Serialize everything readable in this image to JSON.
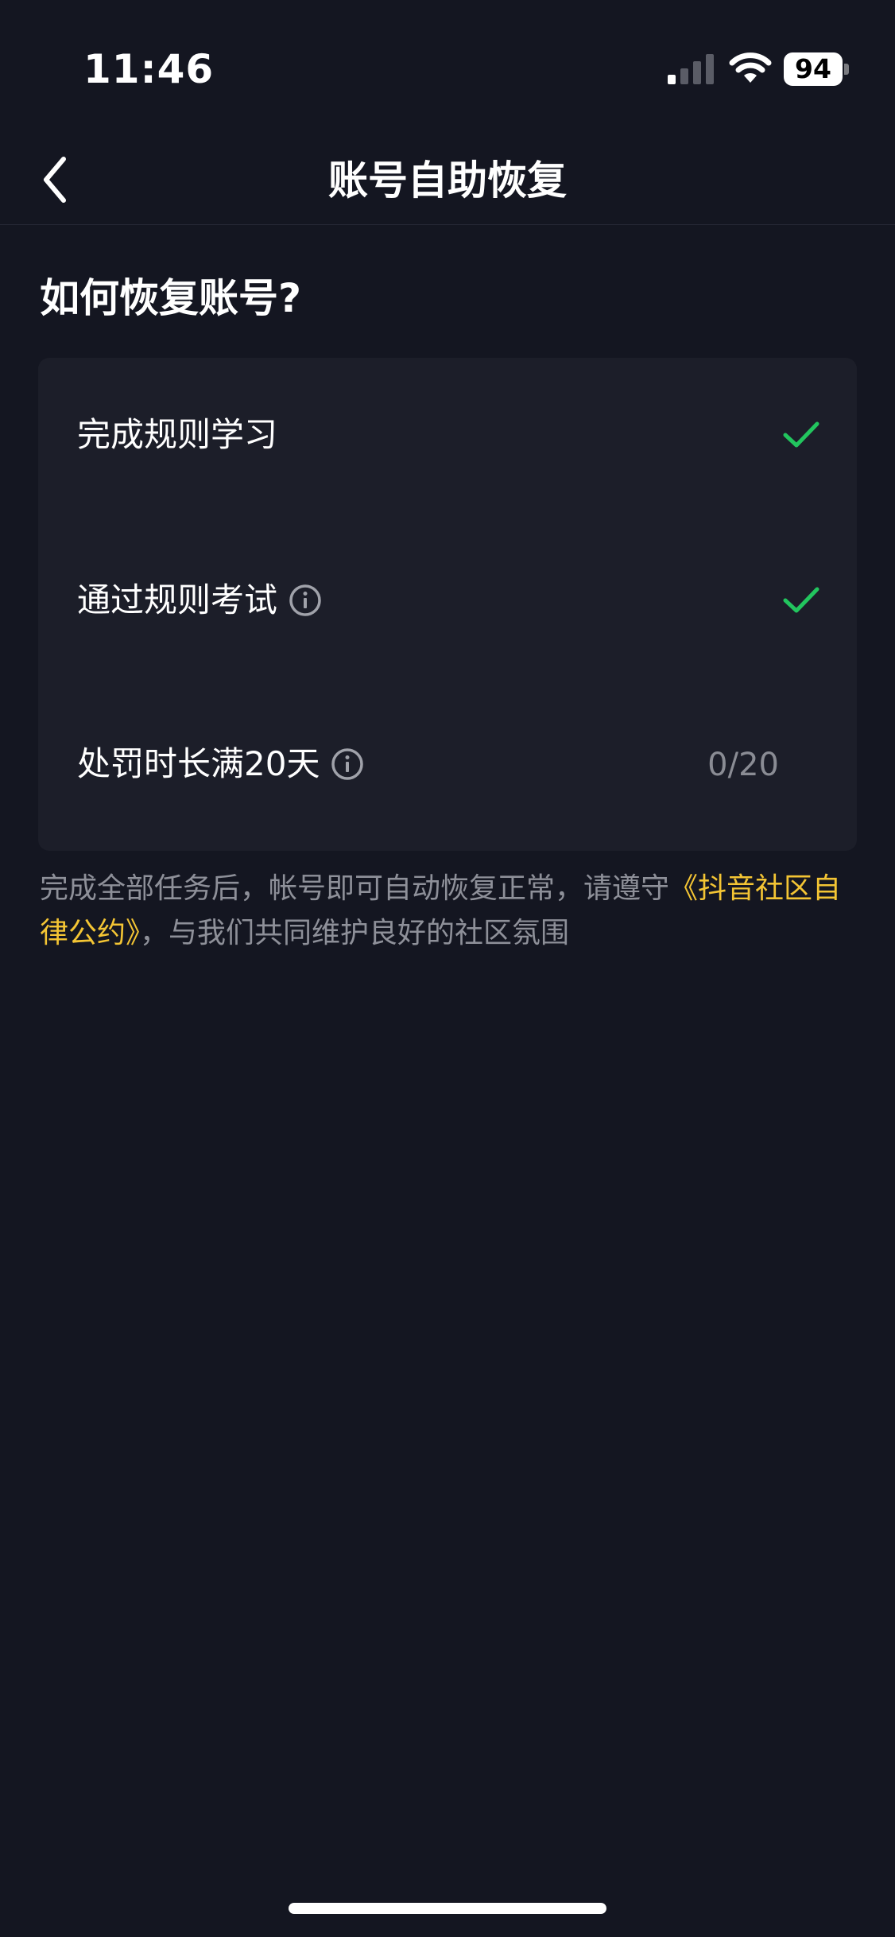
{
  "status_bar": {
    "time": "11:46",
    "battery_level": "94"
  },
  "nav": {
    "title": "账号自助恢复"
  },
  "section": {
    "title": "如何恢复账号?"
  },
  "tasks": [
    {
      "label": "完成规则学习",
      "status": "done"
    },
    {
      "label": "通过规则考试",
      "status": "done",
      "has_info": true
    },
    {
      "label": "处罚时长满20天",
      "status": "in-progress",
      "progress": "0/20",
      "has_info": true
    }
  ],
  "footnote": {
    "before_link": "完成全部任务后，帐号即可自动恢复正常，请遵守",
    "link_text": "《抖音社区自律公约》",
    "after_link": "，与我们共同维护良好的社区氛围"
  },
  "colors": {
    "background": "#141621",
    "card": "#1c1e29",
    "check": "#22c55e",
    "link": "#f4c534",
    "muted_text": "#8e9099"
  }
}
